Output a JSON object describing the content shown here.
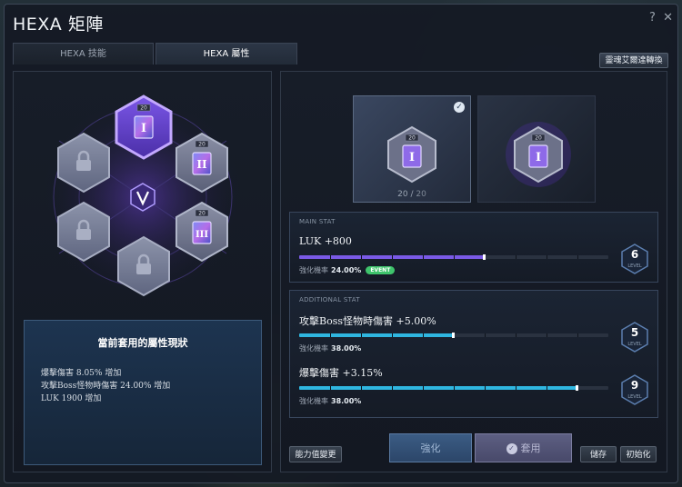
{
  "window": {
    "title": "HEXA 矩陣",
    "help_label": "?",
    "close_label": "✕"
  },
  "tabs": [
    {
      "label": "HEXA 技能",
      "active": false
    },
    {
      "label": "HEXA 屬性",
      "active": true
    }
  ],
  "header": {
    "convert_label": "靈魂艾爾達轉換"
  },
  "hex_grid": {
    "center_icon": "v-emblem-icon",
    "nodes": [
      {
        "name": "stat-node-1",
        "level_label": "20",
        "roman": "I",
        "state": "selected"
      },
      {
        "name": "stat-node-2",
        "level_label": "20",
        "roman": "II",
        "state": "unlocked"
      },
      {
        "name": "stat-node-3",
        "level_label": "20",
        "roman": "III",
        "state": "unlocked"
      },
      {
        "name": "locked-node-1",
        "state": "locked"
      },
      {
        "name": "locked-node-2",
        "state": "locked"
      },
      {
        "name": "locked-node-3",
        "state": "locked"
      }
    ],
    "accent": "#8b5cf6"
  },
  "status": {
    "title": "當前套用的屬性現狀",
    "lines": [
      "爆擊傷害 8.05% 增加",
      "攻擊Boss怪物時傷害 24.00% 增加",
      "LUK 1900 增加"
    ]
  },
  "cards": [
    {
      "level_label": "20",
      "roman": "I",
      "selected": true,
      "count": "20",
      "separator": "/",
      "max": "20"
    },
    {
      "level_label": "20",
      "roman": "I",
      "selected": false
    }
  ],
  "main_stat": {
    "header": "MAIN STAT",
    "name": "LUK +800",
    "rate_label": "強化機率",
    "rate_value": "24.00%",
    "event_label": "EVENT",
    "progress": 0.6,
    "level": "6",
    "level_label": "LEVEL"
  },
  "additional_stats": {
    "header": "ADDITIONAL STAT",
    "items": [
      {
        "name": "攻擊Boss怪物時傷害 +5.00%",
        "rate_label": "強化機率",
        "rate_value": "38.00%",
        "progress": 0.5,
        "level": "5",
        "level_label": "LEVEL"
      },
      {
        "name": "爆擊傷害 +3.15%",
        "rate_label": "強化機率",
        "rate_value": "38.00%",
        "progress": 0.9,
        "level": "9",
        "level_label": "LEVEL"
      }
    ]
  },
  "footer": {
    "change_label": "能力值變更",
    "enhance_label": "強化",
    "apply_label": "套用",
    "save_label": "儲存",
    "reset_label": "初始化"
  },
  "colors": {
    "main_bar": "#7a5ae6",
    "additional_bar": "#2fb6e0"
  }
}
